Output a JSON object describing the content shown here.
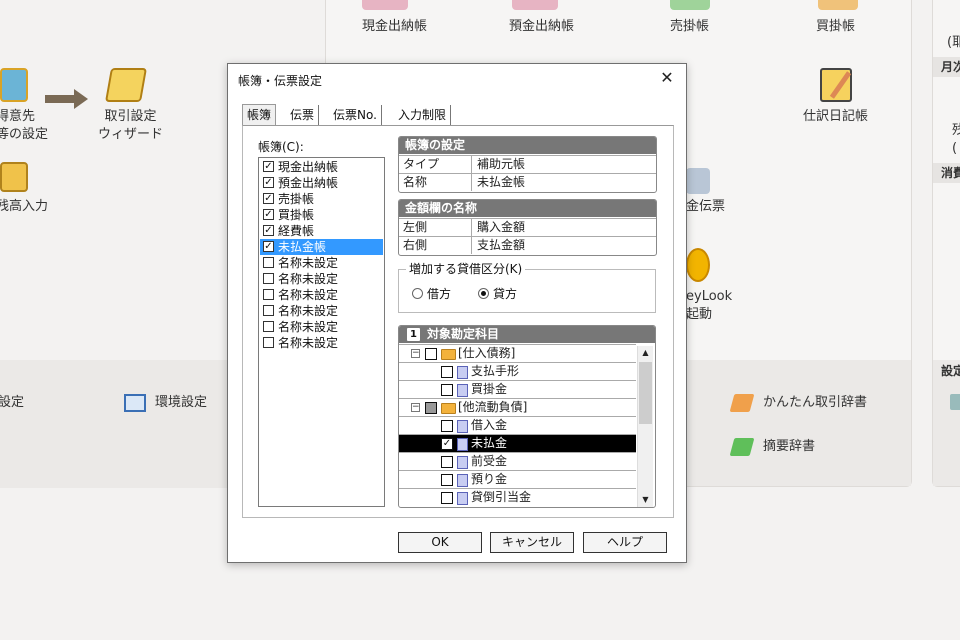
{
  "background": {
    "top_items": [
      "現金出納帳",
      "預金出納帳",
      "売掛帳",
      "買掛帳"
    ],
    "left_item_1": [
      "得意先",
      "等の設定"
    ],
    "left_item_2": [
      "取引設定",
      "ウィザード"
    ],
    "left_item_3": "残高入力",
    "journal_item": "仕訳日記帳",
    "slip_item": "金伝票",
    "moneylook_item": [
      "eyLook",
      "起動"
    ],
    "bottom_items": [
      "設定",
      "環境設定",
      "かんたん取引辞書",
      "摘要辞書"
    ],
    "right_panel": [
      "(耶",
      "月次",
      "残",
      "(",
      "消費",
      "設定"
    ]
  },
  "dialog": {
    "title": "帳簿・伝票設定",
    "close_icon": "close-icon",
    "tabs": [
      "帳簿",
      "伝票",
      "伝票No.",
      "入力制限"
    ],
    "books_label": "帳簿(C):",
    "books": [
      {
        "label": "現金出納帳",
        "checked": true
      },
      {
        "label": "預金出納帳",
        "checked": true
      },
      {
        "label": "売掛帳",
        "checked": true
      },
      {
        "label": "買掛帳",
        "checked": true
      },
      {
        "label": "経費帳",
        "checked": true
      },
      {
        "label": "未払金帳",
        "checked": true,
        "selected": true
      },
      {
        "label": "名称未設定",
        "checked": false
      },
      {
        "label": "名称未設定",
        "checked": false
      },
      {
        "label": "名称未設定",
        "checked": false
      },
      {
        "label": "名称未設定",
        "checked": false
      },
      {
        "label": "名称未設定",
        "checked": false
      },
      {
        "label": "名称未設定",
        "checked": false
      }
    ],
    "book_settings": {
      "header": "帳簿の設定",
      "rows": [
        {
          "key": "タイプ",
          "value": "補助元帳"
        },
        {
          "key": "名称",
          "value": "未払金帳"
        }
      ]
    },
    "amount_names": {
      "header": "金額欄の名称",
      "rows": [
        {
          "key": "左側",
          "value": "購入金額"
        },
        {
          "key": "右側",
          "value": "支払金額"
        }
      ]
    },
    "debit_credit": {
      "label": "増加する貸借区分(K)",
      "options": [
        "借方",
        "貸方"
      ],
      "selected": "貸方"
    },
    "accounts": {
      "header_num": "1",
      "header": "対象勘定科目",
      "rows": [
        {
          "label": "[仕入債務]",
          "type": "folder",
          "check": "none",
          "expander": "⊟"
        },
        {
          "label": "支払手形",
          "type": "item",
          "check": "none"
        },
        {
          "label": "買掛金",
          "type": "item",
          "check": "none"
        },
        {
          "label": "[他流動負債]",
          "type": "folder",
          "check": "partial",
          "expander": "⊟"
        },
        {
          "label": "借入金",
          "type": "item",
          "check": "none"
        },
        {
          "label": "未払金",
          "type": "item",
          "check": "checked",
          "selected": true
        },
        {
          "label": "前受金",
          "type": "item",
          "check": "none"
        },
        {
          "label": "預り金",
          "type": "item",
          "check": "none"
        },
        {
          "label": "貸倒引当金",
          "type": "item",
          "check": "none"
        }
      ]
    },
    "buttons": {
      "ok": "OK",
      "cancel": "キャンセル",
      "help": "ヘルプ"
    }
  },
  "colors": {
    "selection": "#3399ff",
    "group_header": "#777777",
    "folder": "#f3b23c"
  }
}
